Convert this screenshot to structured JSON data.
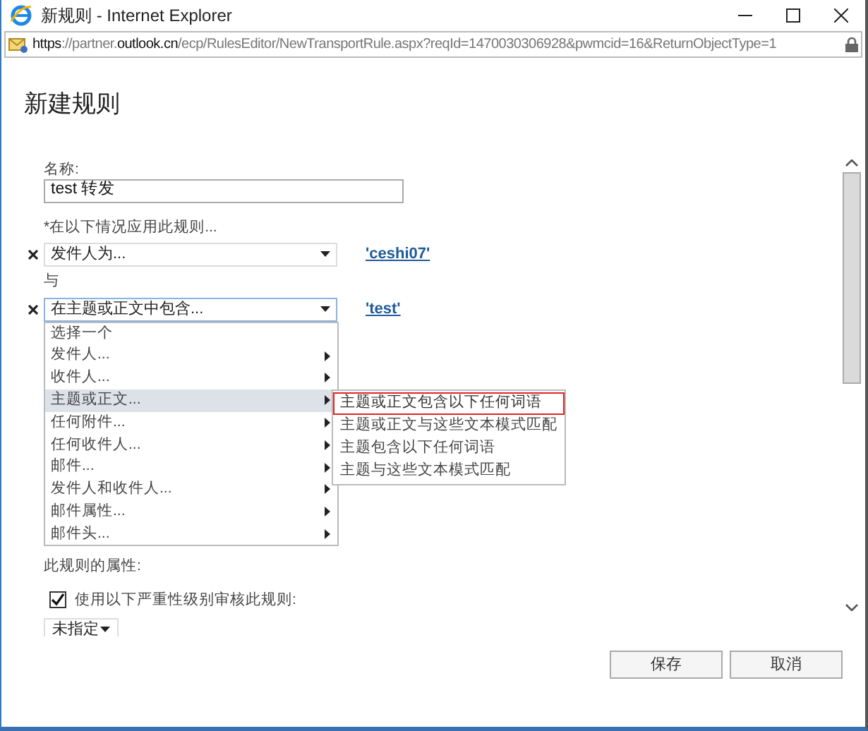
{
  "window": {
    "title": "新规则 - Internet Explorer"
  },
  "address_bar": {
    "url": "**https**://partner.**outlook.cn**/ecp/RulesEditor/NewTransportRule.aspx?reqId=1470030306928&pwmcid=16&ReturnObjectType=1"
  },
  "form": {
    "heading": "新建规则",
    "name_label": "名称:",
    "name_value": "test 转发",
    "conditions_label": "*在以下情况应用此规则...",
    "conditions": [
      {
        "value": "发件人为...",
        "link": "'ceshi07'",
        "focused": false
      },
      {
        "joiner": "与",
        "value": "在主题或正文中包含...",
        "link": "'test'",
        "focused": true
      }
    ],
    "dropdown": [
      {
        "label": "选择一个",
        "submenu": false,
        "selected": false
      },
      {
        "label": "发件人...",
        "submenu": true,
        "selected": false
      },
      {
        "label": "收件人...",
        "submenu": true,
        "selected": false
      },
      {
        "label": "主题或正文...",
        "submenu": true,
        "selected": true
      },
      {
        "label": "任何附件...",
        "submenu": true,
        "selected": false
      },
      {
        "label": "任何收件人...",
        "submenu": true,
        "selected": false
      },
      {
        "label": "邮件...",
        "submenu": true,
        "selected": false
      },
      {
        "label": "发件人和收件人...",
        "submenu": true,
        "selected": false
      },
      {
        "label": "邮件属性...",
        "submenu": true,
        "selected": false
      },
      {
        "label": "邮件头...",
        "submenu": true,
        "selected": false
      }
    ],
    "submenu": [
      {
        "label": "主题或正文包含以下任何词语",
        "selected": true
      },
      {
        "label": "主题或正文与这些文本模式匹配",
        "selected": false
      },
      {
        "label": "主题包含以下任何词语",
        "selected": false
      },
      {
        "label": "主题与这些文本模式匹配",
        "selected": false
      }
    ],
    "properties_label": "此规则的属性:",
    "audit": {
      "label": "使用以下严重性级别审核此规则:",
      "checked": true
    },
    "severity": {
      "value": "未指定"
    }
  },
  "buttons": [
    {
      "label": "保存"
    },
    {
      "label": "取消"
    }
  ]
}
